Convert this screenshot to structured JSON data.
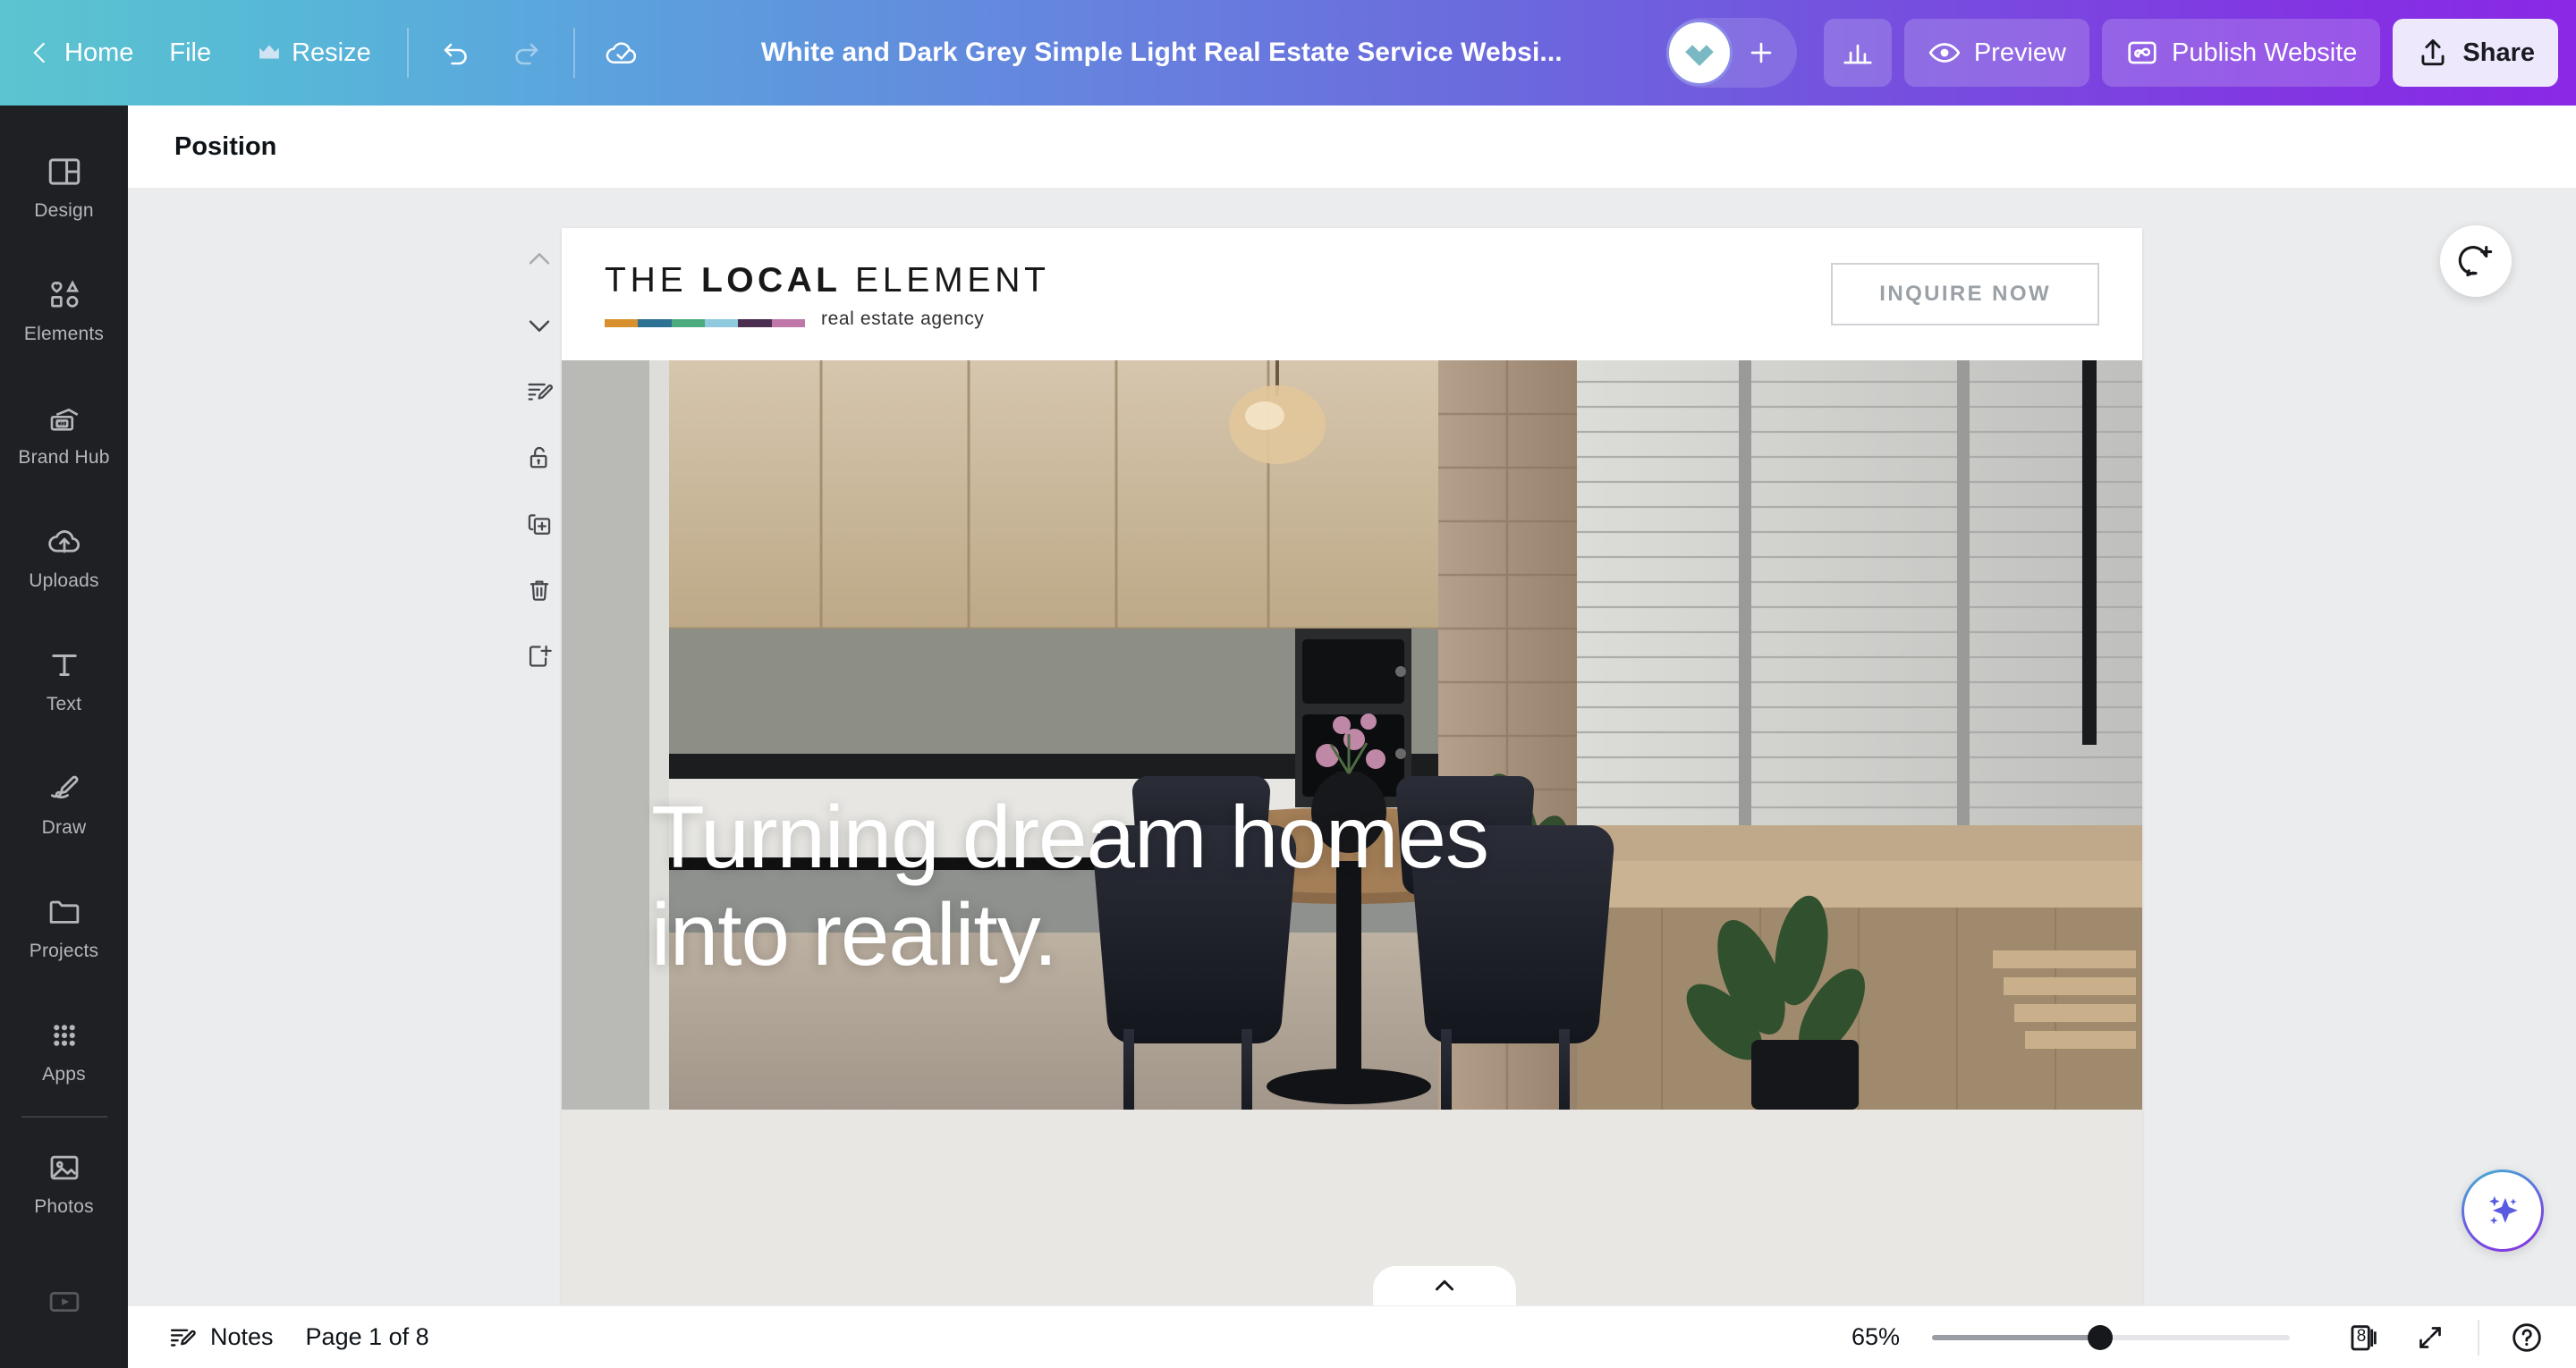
{
  "header": {
    "back_icon": "chevron-left-icon",
    "home_label": "Home",
    "file_label": "File",
    "resize_label": "Resize",
    "resize_icon": "crown-icon",
    "undo_icon": "undo-icon",
    "redo_icon": "redo-icon",
    "cloud_icon": "cloud-saved-icon",
    "doc_title": "White and Dark Grey Simple Light Real Estate Service Websi...",
    "avatar_icon": "heart-avatar-icon",
    "add_collaborator_icon": "plus-icon",
    "insights_icon": "bar-chart-icon",
    "preview_label": "Preview",
    "preview_icon": "eye-icon",
    "publish_label": "Publish Website",
    "publish_icon": "website-icon",
    "share_label": "Share",
    "share_icon": "share-upload-icon",
    "gradient_start": "#5bc4cf",
    "gradient_end": "#8a28e6"
  },
  "sidebar": {
    "items": [
      {
        "label": "Design",
        "icon": "layout-panel-icon"
      },
      {
        "label": "Elements",
        "icon": "shapes-icon"
      },
      {
        "label": "Brand Hub",
        "icon": "brand-card-icon"
      },
      {
        "label": "Uploads",
        "icon": "cloud-upload-icon"
      },
      {
        "label": "Text",
        "icon": "text-t-icon"
      },
      {
        "label": "Draw",
        "icon": "pencil-draw-icon"
      },
      {
        "label": "Projects",
        "icon": "folder-icon"
      },
      {
        "label": "Apps",
        "icon": "grid-dots-icon"
      }
    ],
    "after_separator": [
      {
        "label": "Photos",
        "icon": "image-icon"
      },
      {
        "label": "",
        "icon": "video-icon"
      }
    ]
  },
  "subbar": {
    "position_label": "Position"
  },
  "page_tools": [
    {
      "name": "move-page-up",
      "icon": "chevron-up-icon"
    },
    {
      "name": "move-page-down",
      "icon": "chevron-down-icon"
    },
    {
      "name": "page-notes",
      "icon": "notes-pencil-icon"
    },
    {
      "name": "lock-page",
      "icon": "lock-open-icon"
    },
    {
      "name": "duplicate-page",
      "icon": "duplicate-icon"
    },
    {
      "name": "delete-page",
      "icon": "trash-icon"
    },
    {
      "name": "add-page",
      "icon": "add-page-icon"
    }
  ],
  "canvas": {
    "comment_icon": "add-comment-icon",
    "collapse_icon": "chevron-up-icon",
    "magic_icon": "magic-sparkle-icon",
    "site": {
      "logo_top": "THE ",
      "logo_bold": "LOCAL",
      "logo_rest": " ELEMENT",
      "logo_tagline": "real estate agency",
      "swatches": [
        "#d8902f",
        "#2d7195",
        "#4cab7e",
        "#8ec9de",
        "#4b2f50",
        "#bf77aa"
      ],
      "cta_label": "INQUIRE NOW",
      "headline": "Turning dream homes\ninto reality."
    }
  },
  "bottom": {
    "notes_label": "Notes",
    "notes_icon": "notes-pencil-icon",
    "page_indicator": "Page 1 of 8",
    "zoom_value": "65%",
    "page_count": "8",
    "grid_icon": "page-stack-icon",
    "fullscreen_icon": "expand-icon",
    "help_icon": "help-circle-icon"
  }
}
